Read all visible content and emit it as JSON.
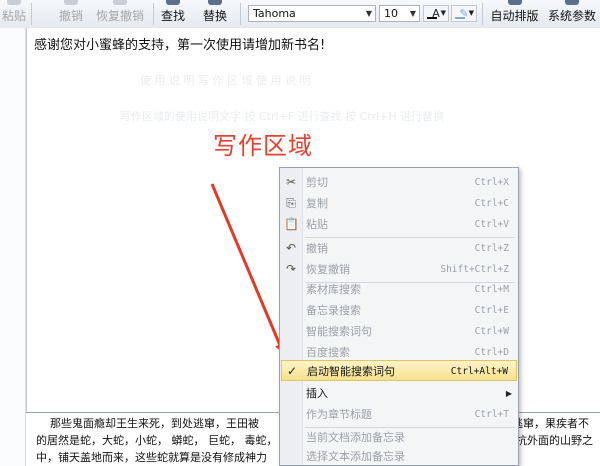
{
  "toolbar": {
    "paste_label": "粘贴",
    "undo_label": "撤销",
    "redo_label": "恢复撤销",
    "find_label": "查找",
    "replace_label": "替换",
    "font_name": "Tahoma",
    "font_size": "10",
    "text_color_glyph": "A",
    "highlight_glyph": "✎",
    "auto_layout_label": "自动排版",
    "settings_label": "系统参数"
  },
  "editor": {
    "welcome_text": "感谢您对小蜜蜂的支持，第一次使用请增加新书名!",
    "ghost_row1": "使  用  说  明     写  作  区  域  使  用  说  明",
    "ghost_row2": "写作区域的使用说明文字   按 Ctrl+F 进行查找   按 Ctrl+H 进行替换"
  },
  "annotation": {
    "label": "写作区域",
    "color": "#e8402f"
  },
  "lower_pane": {
    "line1_left": "那些鬼面瘾却王生来死，到处逃窜，王田被",
    "line1_right": "逃窜，果疾者不",
    "line2_left": "的居然是蛇，大蛇，小蛇，  蟒蛇，  巨蛇，  毒蛇，",
    "line2_right": "抗外面的山野之",
    "line3_left": "中，铺天盖地而来，这些蛇就算是没有修成神力"
  },
  "context_menu": {
    "items": [
      {
        "icon": "scissors-icon",
        "glyph": "✂",
        "label": "剪切",
        "shortcut": "Ctrl+X",
        "enabled": false
      },
      {
        "icon": "copy-icon",
        "glyph": "⎘",
        "label": "复制",
        "shortcut": "Ctrl+C",
        "enabled": false
      },
      {
        "icon": "paste-icon",
        "glyph": "📋",
        "label": "粘贴",
        "shortcut": "Ctrl+V",
        "enabled": false
      },
      {
        "icon": "undo-icon",
        "glyph": "↶",
        "label": "撤销",
        "shortcut": "Ctrl+Z",
        "enabled": false
      },
      {
        "icon": "redo-icon",
        "glyph": "↷",
        "label": "恢复撤销",
        "shortcut": "Shift+Ctrl+Z",
        "enabled": false
      },
      {
        "icon": "",
        "glyph": "",
        "label": "素材库搜索",
        "shortcut": "Ctrl+M",
        "enabled": false
      },
      {
        "icon": "",
        "glyph": "",
        "label": "备忘录搜索",
        "shortcut": "Ctrl+E",
        "enabled": false
      },
      {
        "icon": "",
        "glyph": "",
        "label": "智能搜索词句",
        "shortcut": "Ctrl+W",
        "enabled": false
      },
      {
        "icon": "",
        "glyph": "",
        "label": "百度搜索",
        "shortcut": "Ctrl+D",
        "enabled": false
      },
      {
        "icon": "checkmark-icon",
        "glyph": "✓",
        "label": "启动智能搜索词句",
        "shortcut": "Ctrl+Alt+W",
        "enabled": true,
        "checked": true
      },
      {
        "icon": "",
        "glyph": "",
        "label": "插入",
        "shortcut": "",
        "enabled": true,
        "submenu": true
      },
      {
        "icon": "",
        "glyph": "",
        "label": "作为章节标题",
        "shortcut": "Ctrl+T",
        "enabled": false
      },
      {
        "icon": "",
        "glyph": "",
        "label": "当前文档添加备忘录",
        "shortcut": "",
        "enabled": false
      },
      {
        "icon": "",
        "glyph": "",
        "label": "选择文本添加备忘录",
        "shortcut": "",
        "enabled": false
      }
    ]
  }
}
